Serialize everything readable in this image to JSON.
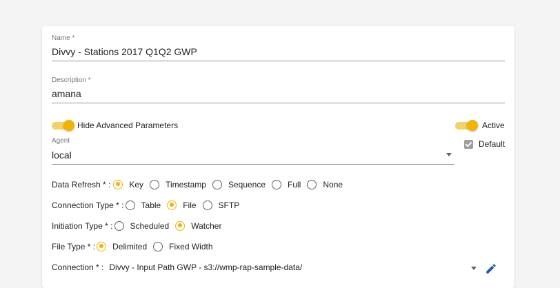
{
  "name_field": {
    "label": "Name *",
    "value": "Divvy - Stations 2017 Q1Q2 GWP"
  },
  "description_field": {
    "label": "Description *",
    "value": "amana"
  },
  "toggles": {
    "hide_advanced": {
      "label": "Hide Advanced Parameters",
      "on": true
    },
    "active": {
      "label": "Active",
      "on": true
    }
  },
  "agent_field": {
    "label": "Agent",
    "value": "local"
  },
  "default_checkbox": {
    "label": "Default",
    "checked": true
  },
  "data_refresh": {
    "label": "Data Refresh * :",
    "options": [
      "Key",
      "Timestamp",
      "Sequence",
      "Full",
      "None"
    ],
    "selected": "Key"
  },
  "connection_type": {
    "label": "Connection Type * :",
    "options": [
      "Table",
      "File",
      "SFTP"
    ],
    "selected": "File"
  },
  "initiation_type": {
    "label": "Initiation Type * :",
    "options": [
      "Scheduled",
      "Watcher"
    ],
    "selected": "Watcher"
  },
  "file_type": {
    "label": "File Type * :",
    "options": [
      "Delimited",
      "Fixed Width"
    ],
    "selected": "Delimited"
  },
  "connection": {
    "label": "Connection * :",
    "value": "Divvy - Input Path GWP - s3://wmp-rap-sample-data/",
    "icons": {
      "dropdown": "chevron-down-icon",
      "edit": "pencil-icon"
    }
  },
  "colors": {
    "accent": "#f3b400",
    "accent_light": "#f6cf66",
    "edit_icon": "#1e5aa8"
  }
}
